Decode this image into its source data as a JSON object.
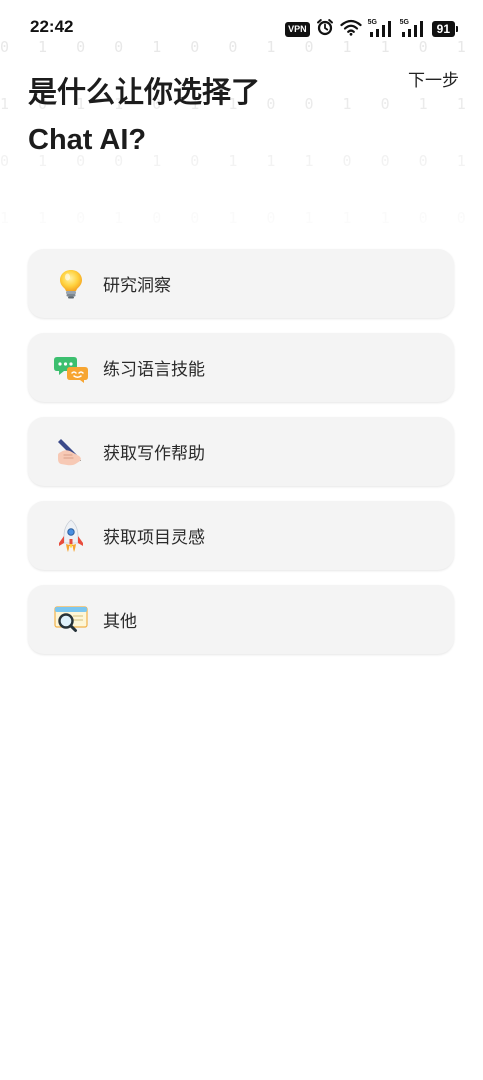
{
  "status_bar": {
    "time": "22:42",
    "vpn_label": "VPN",
    "signal_1_label": "5G",
    "signal_2_label": "5G",
    "battery_level": "91",
    "icons": [
      "vpn-icon",
      "alarm-icon",
      "wifi-icon",
      "signal-5g-icon",
      "signal-5g-icon",
      "battery-icon"
    ]
  },
  "header": {
    "next_label": "下一步",
    "title_line1": "是什么让你选择了",
    "title_line2": "Chat AI?"
  },
  "options": [
    {
      "label": "研究洞察",
      "icon": "light-bulb-icon"
    },
    {
      "label": "练习语言技能",
      "icon": "speech-bubbles-icon"
    },
    {
      "label": "获取写作帮助",
      "icon": "writing-hand-icon"
    },
    {
      "label": "获取项目灵感",
      "icon": "rocket-icon"
    },
    {
      "label": "其他",
      "icon": "magnifier-icon"
    }
  ],
  "colors": {
    "background": "#ffffff",
    "card": "#f4f4f4",
    "text": "#222222",
    "binary_pattern": "#e6e6e6"
  }
}
